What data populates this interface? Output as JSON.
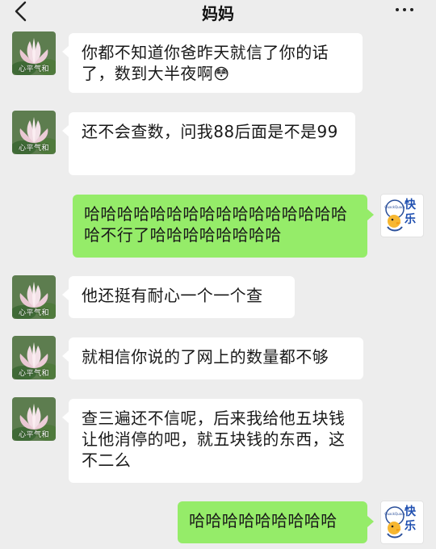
{
  "header": {
    "title": "妈妈",
    "back_icon": "chevron-left-icon",
    "more_icon": "ellipsis-icon"
  },
  "contacts": {
    "mom_avatar_text": "心平气和",
    "me_avatar_text": "快乐"
  },
  "messages": [
    {
      "from": "mom",
      "text": "你都不知道你爸昨天就信了你的话了，数到大半夜啊",
      "emoji": "😳"
    },
    {
      "from": "mom",
      "text": "还不会查数，问我88后面是不是99"
    },
    {
      "from": "me",
      "text": "哈哈哈哈哈哈哈哈哈哈哈哈哈哈哈哈哈不行了哈哈哈哈哈哈哈哈"
    },
    {
      "from": "mom",
      "text": "他还挺有耐心一个一个查"
    },
    {
      "from": "mom",
      "text": "就相信你说的了网上的数量都不够"
    },
    {
      "from": "mom",
      "text": "查三遍还不信呢，后来我给他五块钱让他消停的吧，就五块钱的东西，这不二么"
    },
    {
      "from": "me",
      "text": "哈哈哈哈哈哈哈哈哈"
    }
  ],
  "colors": {
    "background": "#ededed",
    "incoming_bubble": "#ffffff",
    "outgoing_bubble": "#95ec69"
  }
}
